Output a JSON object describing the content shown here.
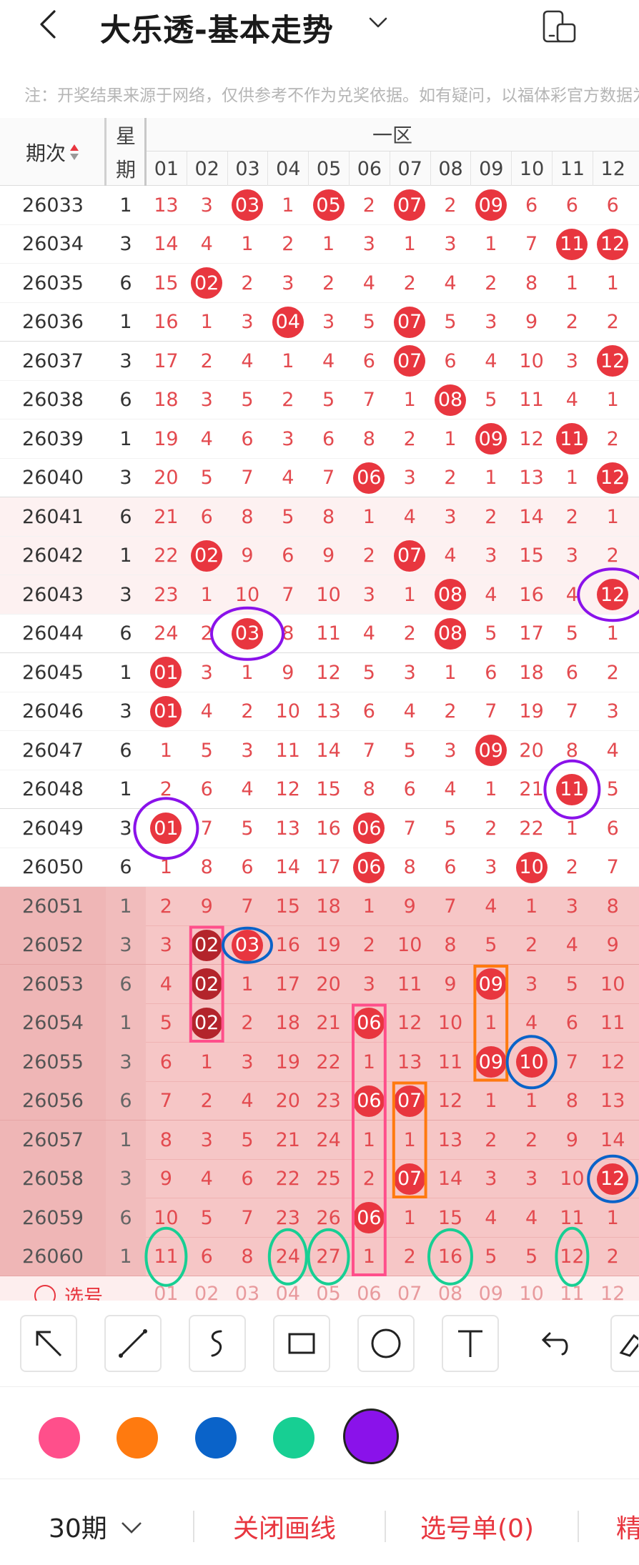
{
  "header": {
    "title": "大乐透-基本走势",
    "notice": "注：开奖结果来源于网络，仅供参考不作为兑奖依据。如有疑问，以福体彩官方数据为准"
  },
  "table": {
    "col_issue": "期次",
    "col_week": [
      "星",
      "期"
    ],
    "zone_label": "一区",
    "columns": [
      "01",
      "02",
      "03",
      "04",
      "05",
      "06",
      "07",
      "08",
      "09",
      "10",
      "11",
      "12"
    ],
    "rows": [
      {
        "issue": "26033",
        "week": "1",
        "cells": [
          "13",
          "3",
          "03",
          "1",
          "05",
          "2",
          "07",
          "2",
          "09",
          "6",
          "6",
          "6"
        ],
        "hits": [
          2,
          4,
          6,
          8
        ]
      },
      {
        "issue": "26034",
        "week": "3",
        "cells": [
          "14",
          "4",
          "1",
          "2",
          "1",
          "3",
          "1",
          "3",
          "1",
          "7",
          "11",
          "12"
        ],
        "hits": [
          10,
          11
        ]
      },
      {
        "issue": "26035",
        "week": "6",
        "cells": [
          "15",
          "02",
          "2",
          "3",
          "2",
          "4",
          "2",
          "4",
          "2",
          "8",
          "1",
          "1"
        ],
        "hits": [
          1
        ]
      },
      {
        "issue": "26036",
        "week": "1",
        "cells": [
          "16",
          "1",
          "3",
          "04",
          "3",
          "5",
          "07",
          "5",
          "3",
          "9",
          "2",
          "2"
        ],
        "hits": [
          3,
          6
        ]
      },
      {
        "issue": "26037",
        "week": "3",
        "cells": [
          "17",
          "2",
          "4",
          "1",
          "4",
          "6",
          "07",
          "6",
          "4",
          "10",
          "3",
          "12"
        ],
        "hits": [
          6,
          11
        ]
      },
      {
        "issue": "26038",
        "week": "6",
        "cells": [
          "18",
          "3",
          "5",
          "2",
          "5",
          "7",
          "1",
          "08",
          "5",
          "11",
          "4",
          "1"
        ],
        "hits": [
          7
        ]
      },
      {
        "issue": "26039",
        "week": "1",
        "cells": [
          "19",
          "4",
          "6",
          "3",
          "6",
          "8",
          "2",
          "1",
          "09",
          "12",
          "11",
          "2"
        ],
        "hits": [
          8,
          10
        ]
      },
      {
        "issue": "26040",
        "week": "3",
        "cells": [
          "20",
          "5",
          "7",
          "4",
          "7",
          "06",
          "3",
          "2",
          "1",
          "13",
          "1",
          "12"
        ],
        "hits": [
          5,
          11
        ]
      },
      {
        "issue": "26041",
        "week": "6",
        "cells": [
          "21",
          "6",
          "8",
          "5",
          "8",
          "1",
          "4",
          "3",
          "2",
          "14",
          "2",
          "1"
        ],
        "hits": []
      },
      {
        "issue": "26042",
        "week": "1",
        "cells": [
          "22",
          "02",
          "9",
          "6",
          "9",
          "2",
          "07",
          "4",
          "3",
          "15",
          "3",
          "2"
        ],
        "hits": [
          1,
          6
        ]
      },
      {
        "issue": "26043",
        "week": "3",
        "cells": [
          "23",
          "1",
          "10",
          "7",
          "10",
          "3",
          "1",
          "08",
          "4",
          "16",
          "4",
          "12"
        ],
        "hits": [
          7,
          11
        ]
      },
      {
        "issue": "26044",
        "week": "6",
        "cells": [
          "24",
          "2",
          "03",
          "8",
          "11",
          "4",
          "2",
          "08",
          "5",
          "17",
          "5",
          "1"
        ],
        "hits": [
          2,
          7
        ]
      },
      {
        "issue": "26045",
        "week": "1",
        "cells": [
          "01",
          "3",
          "1",
          "9",
          "12",
          "5",
          "3",
          "1",
          "6",
          "18",
          "6",
          "2"
        ],
        "hits": [
          0
        ]
      },
      {
        "issue": "26046",
        "week": "3",
        "cells": [
          "01",
          "4",
          "2",
          "10",
          "13",
          "6",
          "4",
          "2",
          "7",
          "19",
          "7",
          "3"
        ],
        "hits": [
          0
        ]
      },
      {
        "issue": "26047",
        "week": "6",
        "cells": [
          "1",
          "5",
          "3",
          "11",
          "14",
          "7",
          "5",
          "3",
          "09",
          "20",
          "8",
          "4"
        ],
        "hits": [
          8
        ]
      },
      {
        "issue": "26048",
        "week": "1",
        "cells": [
          "2",
          "6",
          "4",
          "12",
          "15",
          "8",
          "6",
          "4",
          "1",
          "21",
          "11",
          "5"
        ],
        "hits": [
          10
        ]
      },
      {
        "issue": "26049",
        "week": "3",
        "cells": [
          "01",
          "7",
          "5",
          "13",
          "16",
          "06",
          "7",
          "5",
          "2",
          "22",
          "1",
          "6"
        ],
        "hits": [
          0,
          5
        ]
      },
      {
        "issue": "26050",
        "week": "6",
        "cells": [
          "1",
          "8",
          "6",
          "14",
          "17",
          "06",
          "8",
          "6",
          "3",
          "10",
          "2",
          "7"
        ],
        "hits": [
          5,
          9
        ]
      },
      {
        "issue": "26051",
        "week": "1",
        "cells": [
          "2",
          "9",
          "7",
          "15",
          "18",
          "1",
          "9",
          "7",
          "4",
          "1",
          "3",
          "8"
        ],
        "hits": []
      },
      {
        "issue": "26052",
        "week": "3",
        "cells": [
          "3",
          "02",
          "03",
          "16",
          "19",
          "2",
          "10",
          "8",
          "5",
          "2",
          "4",
          "9"
        ],
        "hits": [
          1,
          2
        ]
      },
      {
        "issue": "26053",
        "week": "6",
        "cells": [
          "4",
          "02",
          "1",
          "17",
          "20",
          "3",
          "11",
          "9",
          "09",
          "3",
          "5",
          "10"
        ],
        "hits": [
          1,
          8
        ]
      },
      {
        "issue": "26054",
        "week": "1",
        "cells": [
          "5",
          "02",
          "2",
          "18",
          "21",
          "06",
          "12",
          "10",
          "1",
          "4",
          "6",
          "11"
        ],
        "hits": [
          1,
          5
        ]
      },
      {
        "issue": "26055",
        "week": "3",
        "cells": [
          "6",
          "1",
          "3",
          "19",
          "22",
          "1",
          "13",
          "11",
          "09",
          "10",
          "7",
          "12"
        ],
        "hits": [
          8,
          9
        ]
      },
      {
        "issue": "26056",
        "week": "6",
        "cells": [
          "7",
          "2",
          "4",
          "20",
          "23",
          "06",
          "07",
          "12",
          "1",
          "1",
          "8",
          "13"
        ],
        "hits": [
          5,
          6
        ]
      },
      {
        "issue": "26057",
        "week": "1",
        "cells": [
          "8",
          "3",
          "5",
          "21",
          "24",
          "1",
          "1",
          "13",
          "2",
          "2",
          "9",
          "14"
        ],
        "hits": []
      },
      {
        "issue": "26058",
        "week": "3",
        "cells": [
          "9",
          "4",
          "6",
          "22",
          "25",
          "2",
          "07",
          "14",
          "3",
          "3",
          "10",
          "12"
        ],
        "hits": [
          6,
          11
        ]
      },
      {
        "issue": "26059",
        "week": "6",
        "cells": [
          "10",
          "5",
          "7",
          "23",
          "26",
          "06",
          "1",
          "15",
          "4",
          "4",
          "11",
          "1"
        ],
        "hits": [
          5
        ]
      },
      {
        "issue": "26060",
        "week": "1",
        "cells": [
          "11",
          "6",
          "8",
          "24",
          "27",
          "1",
          "2",
          "16",
          "5",
          "5",
          "12",
          "2"
        ],
        "hits": []
      }
    ],
    "pick_label": "选号"
  },
  "toolbar": {
    "tools": [
      "arrow-tool-icon",
      "line-tool-icon",
      "freehand-tool-icon",
      "rectangle-tool-icon",
      "circle-tool-icon",
      "text-tool-icon",
      "undo-icon",
      "eraser-icon"
    ],
    "colors": [
      "#ff4f8b",
      "#ff7a0f",
      "#0a63c9",
      "#17cf93",
      "#8a12ea"
    ],
    "selected_color": "#8a12ea"
  },
  "bottom": {
    "period": "30期",
    "close_lines": "关闭画线",
    "pick_list": "选号单(0)",
    "more": "精"
  },
  "theme": {
    "red": "#e8363f",
    "dark_red": "#b3242b",
    "text_red": "#e34a4f"
  }
}
